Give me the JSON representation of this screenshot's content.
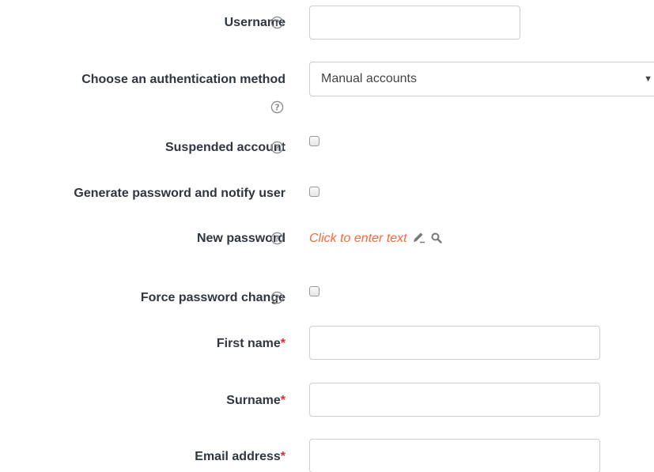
{
  "form": {
    "username": {
      "label": "Username",
      "value": ""
    },
    "auth": {
      "label": "Choose an authentication method",
      "selected": "Manual accounts"
    },
    "suspended": {
      "label": "Suspended account"
    },
    "generate": {
      "label": "Generate password and notify user"
    },
    "new_password": {
      "label": "New password",
      "inplace_text": "Click to enter text"
    },
    "force_change": {
      "label": "Force password change"
    },
    "first_name": {
      "label": "First name",
      "required_mark": "*",
      "value": ""
    },
    "surname": {
      "label": "Surname",
      "required_mark": "*",
      "value": ""
    },
    "email": {
      "label": "Email address",
      "required_mark": "*",
      "value": ""
    }
  },
  "icons": {
    "help": "question-circle-icon",
    "edit": "pencil-icon",
    "search": "search-icon",
    "dropdown": "caret-down-icon"
  },
  "colors": {
    "label": "#2f3640",
    "required": "#e22a2a",
    "inplace_link": "#f7683c",
    "help_icon": "#8c8c8c"
  }
}
